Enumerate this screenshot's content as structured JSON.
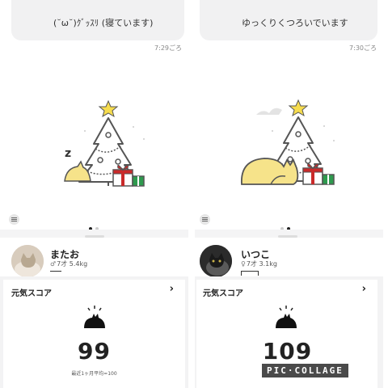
{
  "left": {
    "message": "(˘ω˘)ｸﾞｯｽﾘ (寝ています)",
    "time": "7:29ごろ",
    "pet": {
      "name": "またお",
      "sex_symbol": "♂",
      "meta": "7才 5.4kg"
    },
    "score_title": "元気スコア",
    "score": "99",
    "average_note": "最近1ヶ月平均=100",
    "active_page": 0
  },
  "right": {
    "message": "ゆっくりくつろいでいます",
    "time": "7:30ごろ",
    "pet": {
      "name": "いつこ",
      "sex_symbol": "♀",
      "meta": "7才 3.1kg"
    },
    "score_title": "元気スコア",
    "score": "109",
    "active_page": 1
  },
  "watermark": "PIC·COLLAGE",
  "colors": {
    "cat": "#f6e38a",
    "star": "#f6dc4e",
    "gift_red": "#c92a2a",
    "gift_green": "#2e9a4e",
    "tree_line": "#555555"
  }
}
